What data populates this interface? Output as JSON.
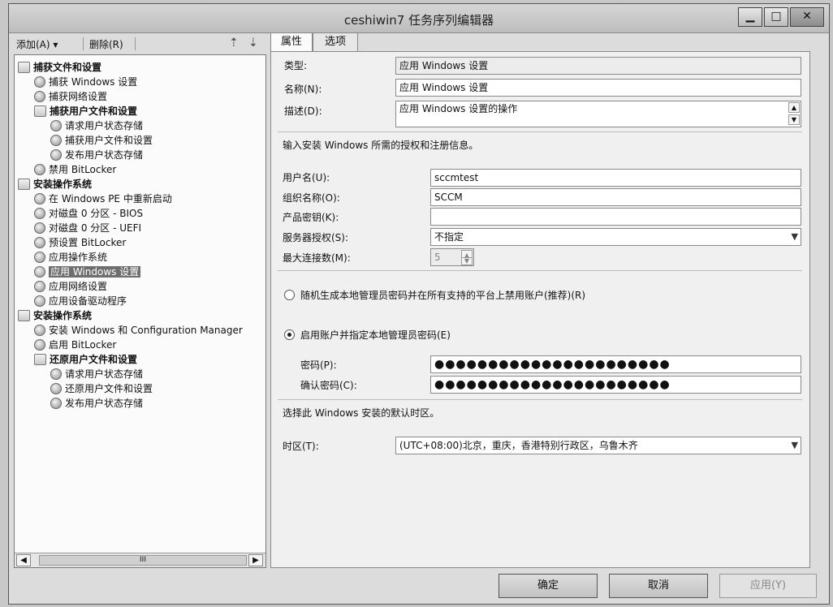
{
  "window": {
    "title": "ceshiwin7 任务序列编辑器"
  },
  "toolbar": {
    "add_label": "添加(A) ▾",
    "remove_label": "删除(R)"
  },
  "tree": {
    "items": [
      {
        "label": "捕获文件和设置",
        "bold": true
      },
      {
        "label": "捕获 Windows 设置"
      },
      {
        "label": "捕获网络设置"
      },
      {
        "label": "捕获用户文件和设置",
        "bold": true
      },
      {
        "label": "请求用户状态存储"
      },
      {
        "label": "捕获用户文件和设置"
      },
      {
        "label": "发布用户状态存储"
      },
      {
        "label": "禁用 BitLocker"
      },
      {
        "label": "安装操作系统",
        "bold": true
      },
      {
        "label": "在 Windows PE 中重新启动"
      },
      {
        "label": "对磁盘 0 分区 - BIOS"
      },
      {
        "label": "对磁盘 0 分区 - UEFI"
      },
      {
        "label": "预设置 BitLocker"
      },
      {
        "label": "应用操作系统"
      },
      {
        "label": "应用 Windows 设置",
        "selected": true
      },
      {
        "label": "应用网络设置"
      },
      {
        "label": "应用设备驱动程序"
      },
      {
        "label": "安装操作系统",
        "bold": true
      },
      {
        "label": "安装 Windows 和 Configuration Manager"
      },
      {
        "label": "启用 BitLocker"
      },
      {
        "label": "还原用户文件和设置",
        "bold": true
      },
      {
        "label": "请求用户状态存储"
      },
      {
        "label": "还原用户文件和设置"
      },
      {
        "label": "发布用户状态存储"
      }
    ],
    "scroll_thumb": "III"
  },
  "tabs": {
    "properties": "属性",
    "options": "选项"
  },
  "form": {
    "type_label": "类型:",
    "type_value": "应用 Windows 设置",
    "name_label": "名称(N):",
    "name_value": "应用 Windows 设置",
    "desc_label": "描述(D):",
    "desc_value": "应用 Windows 设置的操作",
    "license_heading": "输入安装 Windows 所需的授权和注册信息。",
    "username_label": "用户名(U):",
    "username_value": "sccmtest",
    "org_label": "组织名称(O):",
    "org_value": "SCCM",
    "key_label": "产品密钥(K):",
    "key_value": "",
    "server_license_label": "服务器授权(S):",
    "server_license_value": "不指定",
    "max_conn_label": "最大连接数(M):",
    "max_conn_value": "5",
    "radio_random_label": "随机生成本地管理员密码并在所有支持的平台上禁用账户(推荐)(R)",
    "radio_enable_label": "启用账户并指定本地管理员密码(E)",
    "password_label": "密码(P):",
    "password_value": "●●●●●●●●●●●●●●●●●●●●●●",
    "confirm_label": "确认密码(C):",
    "confirm_value": "●●●●●●●●●●●●●●●●●●●●●●",
    "timezone_heading": "选择此 Windows 安装的默认时区。",
    "timezone_label": "时区(T):",
    "timezone_value": "(UTC+08:00)北京，重庆，香港特别行政区，乌鲁木齐"
  },
  "buttons": {
    "ok": "确定",
    "cancel": "取消",
    "apply": "应用(Y)"
  }
}
